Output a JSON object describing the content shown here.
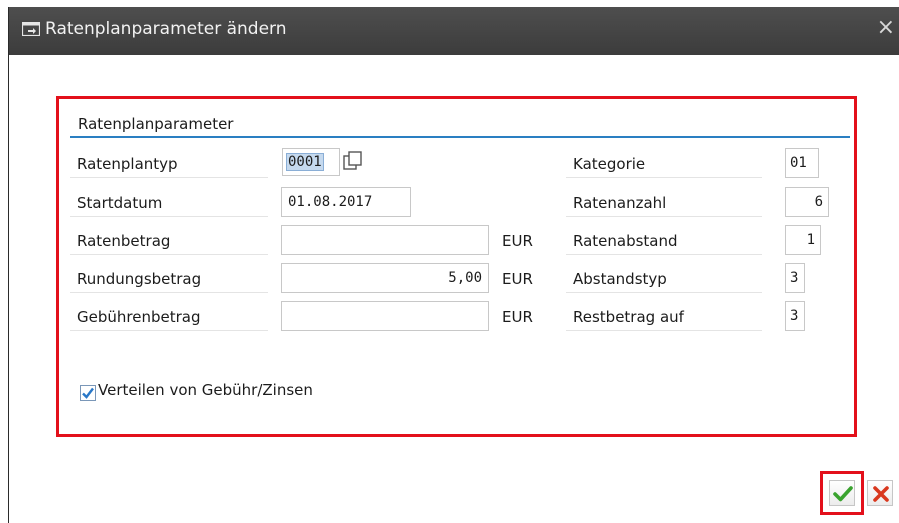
{
  "dialog": {
    "title": "Ratenplanparameter ändern",
    "close_glyph": "×"
  },
  "group": {
    "title": "Ratenplanparameter"
  },
  "fields": {
    "ratenplantyp": {
      "label": "Ratenplantyp",
      "value": "0001"
    },
    "startdatum": {
      "label": "Startdatum",
      "value": "01.08.2017"
    },
    "ratenbetrag": {
      "label": "Ratenbetrag",
      "value": "",
      "unit": "EUR"
    },
    "rundungsbetrag": {
      "label": "Rundungsbetrag",
      "value": "5,00",
      "unit": "EUR"
    },
    "gebuehrenbetrag": {
      "label": "Gebührenbetrag",
      "value": "",
      "unit": "EUR"
    },
    "kategorie": {
      "label": "Kategorie",
      "value": "01"
    },
    "ratenanzahl": {
      "label": "Ratenanzahl",
      "value": "6"
    },
    "ratenabstand": {
      "label": "Ratenabstand",
      "value": "1"
    },
    "abstandstyp": {
      "label": "Abstandstyp",
      "value": "3"
    },
    "restbetrag": {
      "label": "Restbetrag auf",
      "value": "3"
    }
  },
  "checkbox": {
    "label": "Verteilen von Gebühr/Zinsen",
    "checked": true
  },
  "icons": {
    "title": "dialog-window-icon",
    "value_help": "value-help-icon",
    "confirm": "checkmark-icon",
    "cancel": "cancel-x-icon"
  },
  "colors": {
    "titlebar": "#454545",
    "highlight_frame": "#e3101b",
    "group_line": "#2a7fc2",
    "confirm_green": "#3aa32f",
    "cancel_red": "#d9381e"
  }
}
